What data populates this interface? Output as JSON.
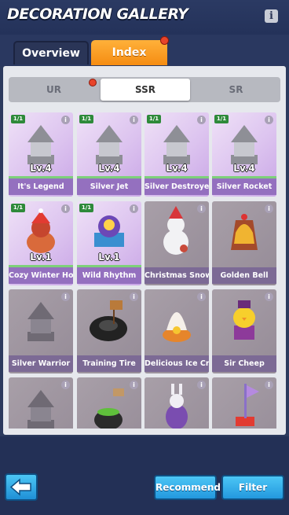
{
  "header": {
    "title": "DECORATION GALLERY"
  },
  "tabs": [
    {
      "label": "Overview"
    },
    {
      "label": "Index"
    }
  ],
  "rarity_tabs": [
    {
      "label": "UR"
    },
    {
      "label": "SSR"
    },
    {
      "label": "SR"
    }
  ],
  "cards": [
    {
      "name": "It's Legend",
      "level": "Lv.4",
      "count": "1/1"
    },
    {
      "name": "Silver Jet",
      "level": "Lv.4",
      "count": "1/1"
    },
    {
      "name": "Silver Destroyer",
      "level": "Lv.4",
      "count": "1/1"
    },
    {
      "name": "Silver Rocket",
      "level": "Lv.4",
      "count": "1/1"
    },
    {
      "name": "Cozy Winter Holi",
      "level": "Lv.1",
      "count": "1/1"
    },
    {
      "name": "Wild Rhythm",
      "level": "Lv.1",
      "count": "1/1"
    },
    {
      "name": "Christmas Snowm",
      "level": "",
      "count": ""
    },
    {
      "name": "Golden Bell",
      "level": "",
      "count": ""
    },
    {
      "name": "Silver Warrior",
      "level": "",
      "count": ""
    },
    {
      "name": "Training Tire",
      "level": "",
      "count": ""
    },
    {
      "name": "Delicious Ice Crea",
      "level": "",
      "count": ""
    },
    {
      "name": "Sir Cheep",
      "level": "",
      "count": ""
    },
    {
      "name": "",
      "level": "",
      "count": ""
    },
    {
      "name": "",
      "level": "",
      "count": ""
    },
    {
      "name": "",
      "level": "",
      "count": ""
    },
    {
      "name": "",
      "level": "",
      "count": ""
    }
  ],
  "buttons": {
    "recommend": "Recommend",
    "filter": "Filter"
  },
  "colors": {
    "accent": "#f58c12",
    "owned": "#dcc3ef",
    "locked": "#958b97",
    "button": "#2398de"
  }
}
